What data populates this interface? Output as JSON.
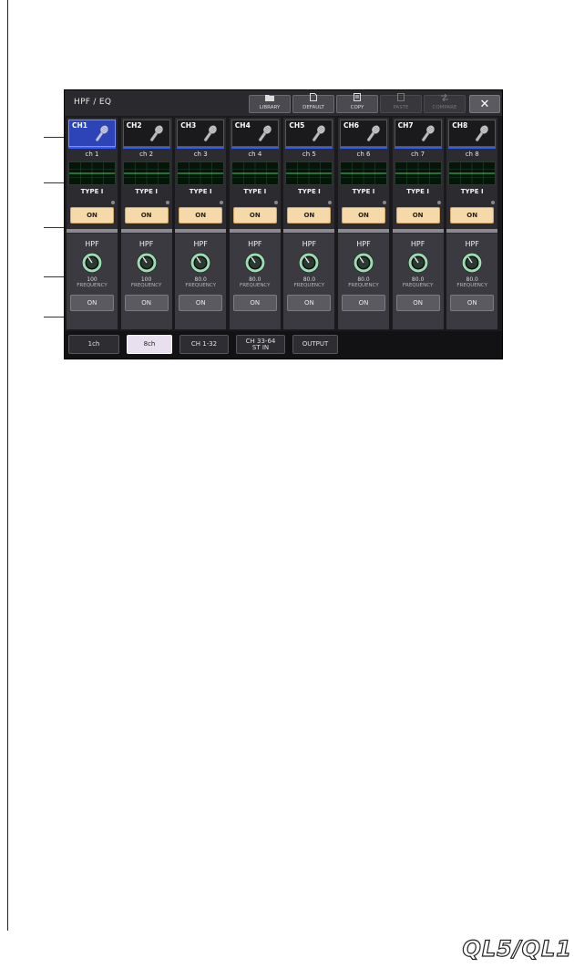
{
  "window": {
    "title": "HPF / EQ",
    "close_symbol": "✕"
  },
  "toolbar": [
    {
      "label": "LIBRARY",
      "icon": "folder-icon",
      "enabled": true
    },
    {
      "label": "DEFAULT",
      "icon": "document-icon",
      "enabled": true
    },
    {
      "label": "COPY",
      "icon": "copy-icon",
      "enabled": true
    },
    {
      "label": "PASTE",
      "icon": "paste-icon",
      "enabled": false
    },
    {
      "label": "COMPARE",
      "icon": "compare-icon",
      "enabled": false
    }
  ],
  "channels": [
    {
      "id": "CH1",
      "name": "ch 1",
      "eq_type": "TYPE I",
      "eq_on": "ON",
      "hpf_label": "HPF",
      "freq": "100",
      "freq_label": "FREQUENCY",
      "hpf_on": "ON",
      "selected": true
    },
    {
      "id": "CH2",
      "name": "ch 2",
      "eq_type": "TYPE I",
      "eq_on": "ON",
      "hpf_label": "HPF",
      "freq": "100",
      "freq_label": "FREQUENCY",
      "hpf_on": "ON",
      "selected": false
    },
    {
      "id": "CH3",
      "name": "ch 3",
      "eq_type": "TYPE I",
      "eq_on": "ON",
      "hpf_label": "HPF",
      "freq": "80.0",
      "freq_label": "FREQUENCY",
      "hpf_on": "ON",
      "selected": false
    },
    {
      "id": "CH4",
      "name": "ch 4",
      "eq_type": "TYPE I",
      "eq_on": "ON",
      "hpf_label": "HPF",
      "freq": "80.0",
      "freq_label": "FREQUENCY",
      "hpf_on": "ON",
      "selected": false
    },
    {
      "id": "CH5",
      "name": "ch 5",
      "eq_type": "TYPE I",
      "eq_on": "ON",
      "hpf_label": "HPF",
      "freq": "80.0",
      "freq_label": "FREQUENCY",
      "hpf_on": "ON",
      "selected": false
    },
    {
      "id": "CH6",
      "name": "ch 6",
      "eq_type": "TYPE I",
      "eq_on": "ON",
      "hpf_label": "HPF",
      "freq": "80.0",
      "freq_label": "FREQUENCY",
      "hpf_on": "ON",
      "selected": false
    },
    {
      "id": "CH7",
      "name": "ch 7",
      "eq_type": "TYPE I",
      "eq_on": "ON",
      "hpf_label": "HPF",
      "freq": "80.0",
      "freq_label": "FREQUENCY",
      "hpf_on": "ON",
      "selected": false
    },
    {
      "id": "CH8",
      "name": "ch 8",
      "eq_type": "TYPE I",
      "eq_on": "ON",
      "hpf_label": "HPF",
      "freq": "80.0",
      "freq_label": "FREQUENCY",
      "hpf_on": "ON",
      "selected": false
    }
  ],
  "tabs": [
    {
      "label": "1ch",
      "active": false
    },
    {
      "label": "8ch",
      "active": true
    },
    {
      "label": "CH 1-32",
      "active": false
    },
    {
      "label": "CH 33-64\nST IN",
      "active": false
    },
    {
      "label": "OUTPUT",
      "active": false
    }
  ],
  "footer": {
    "brand": "QL5/QL1"
  },
  "colors": {
    "selected_channel": "#2c44b8",
    "eq_on_button": "#f6d9a8",
    "channel_color_bar": "#2f5bff",
    "knob_ring": "#9bdcb0"
  }
}
